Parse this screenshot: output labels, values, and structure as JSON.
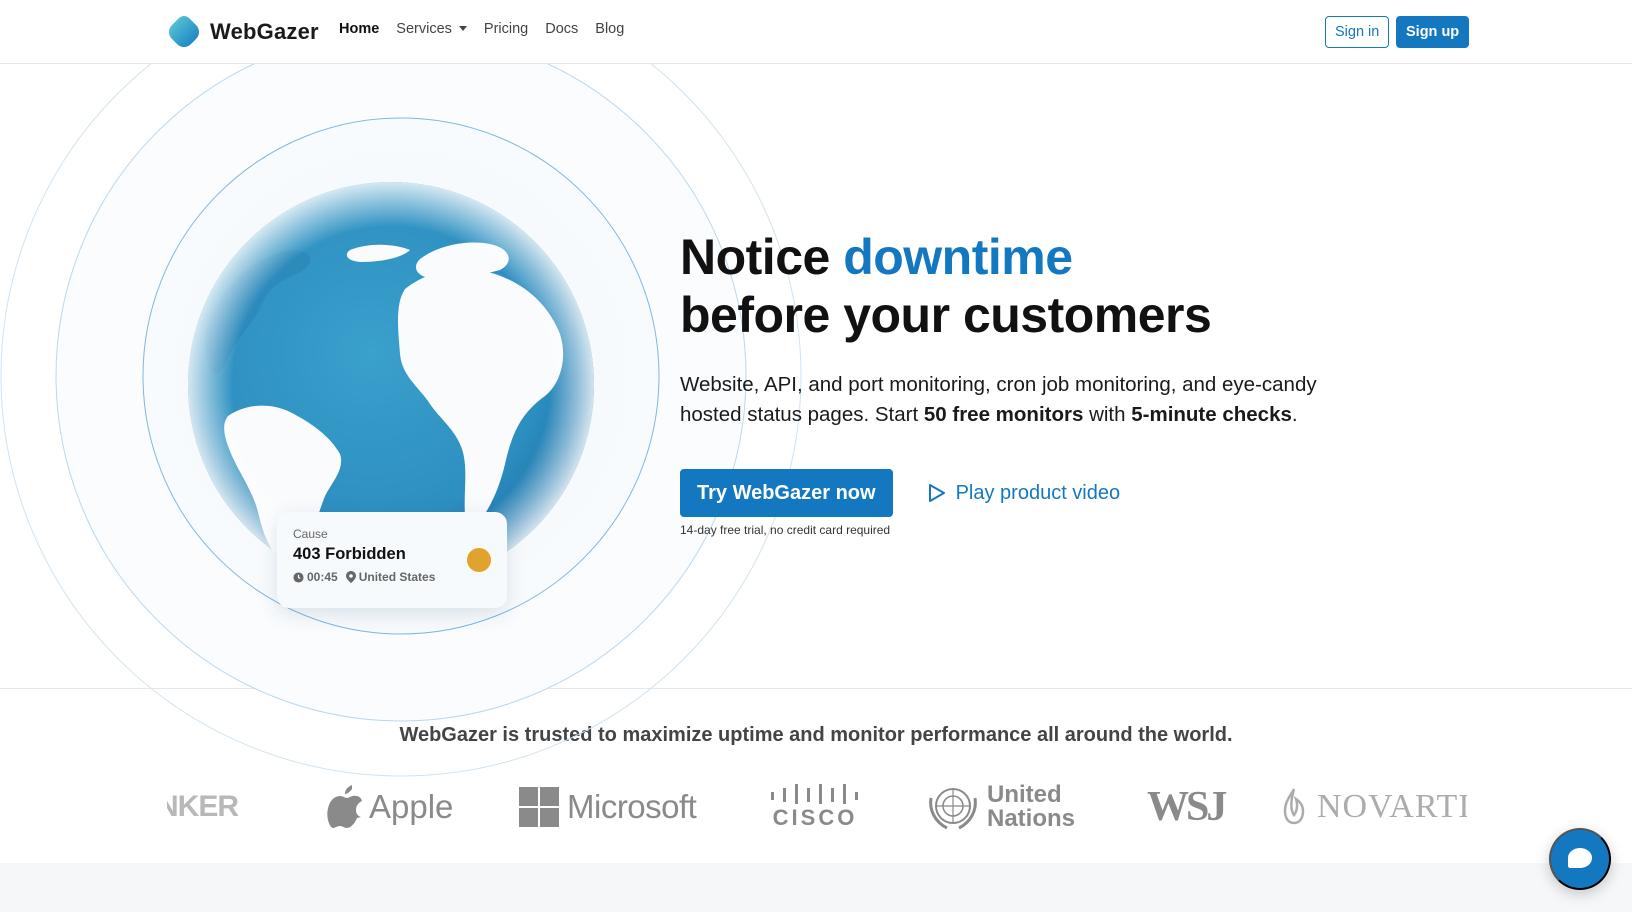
{
  "brand": {
    "name": "WebGazer"
  },
  "nav": {
    "items": [
      {
        "label": "Home",
        "active": true
      },
      {
        "label": "Services",
        "dropdown": true
      },
      {
        "label": "Pricing"
      },
      {
        "label": "Docs"
      },
      {
        "label": "Blog"
      }
    ],
    "signin_label": "Sign in",
    "signup_label": "Sign up"
  },
  "hero": {
    "title_part1": "Notice ",
    "title_accent": "downtime",
    "title_part2": "before your customers",
    "sub_part1": "Website, API, and port monitoring, cron job monitoring, and eye-candy hosted status pages. Start ",
    "sub_bold1": "50 free monitors",
    "sub_part2": " with ",
    "sub_bold2": "5-minute checks",
    "sub_part3": ".",
    "cta_label": "Try WebGazer now",
    "video_label": "Play product video",
    "cta_note": "14-day free trial, no credit card required"
  },
  "status_card": {
    "label": "Cause",
    "title": "403 Forbidden",
    "time": "00:45",
    "location": "United States",
    "dot_color": "#e0a42c"
  },
  "trusted": {
    "title": "WebGazer is trusted to maximize uptime and monitor performance all around the world.",
    "logos": [
      {
        "name": "anker-logo",
        "text": "NKER"
      },
      {
        "name": "apple-logo",
        "text": "Apple"
      },
      {
        "name": "microsoft-logo",
        "text": "Microsoft"
      },
      {
        "name": "cisco-logo",
        "text": "CISCO"
      },
      {
        "name": "united-nations-logo",
        "line1": "United",
        "line2": "Nations"
      },
      {
        "name": "wsj-logo",
        "text": "WSJ"
      },
      {
        "name": "novartis-logo",
        "text": "NOVARTIS"
      }
    ]
  },
  "colors": {
    "brand": "#1478c0",
    "text": "#111111",
    "muted": "#8a8a8a"
  }
}
